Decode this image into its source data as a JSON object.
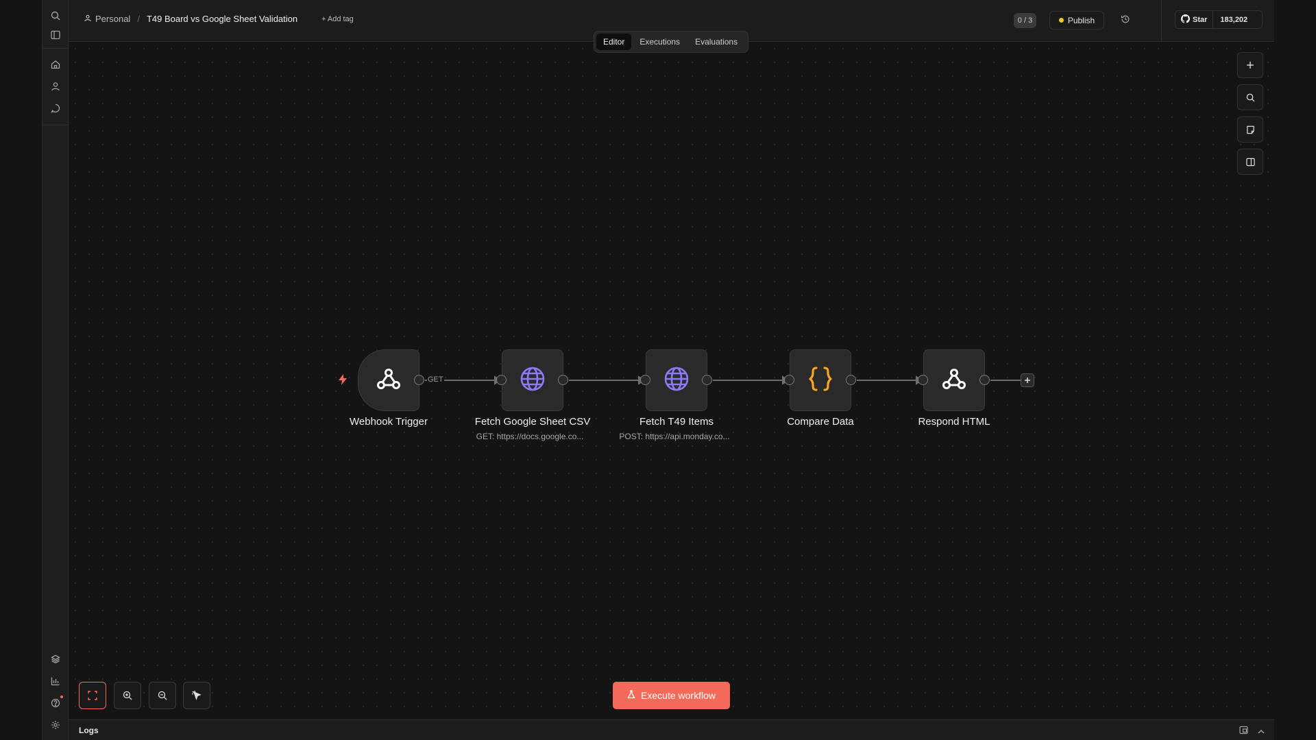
{
  "breadcrumb": {
    "project": "Personal",
    "separator": "/",
    "workflow_name": "T49 Board vs Google Sheet Validation",
    "add_tag": "+ Add tag"
  },
  "header": {
    "counter": "0 / 3",
    "publish_label": "Publish",
    "star_label": "Star",
    "star_count": "183,202"
  },
  "tabs": [
    {
      "label": "Editor",
      "active": true
    },
    {
      "label": "Executions"
    },
    {
      "label": "Evaluations"
    }
  ],
  "nodes": [
    {
      "title": "Webhook Trigger",
      "subtitle": "",
      "icon": "webhook-icon"
    },
    {
      "title": "Fetch Google Sheet CSV",
      "subtitle": "GET: https://docs.google.co...",
      "icon": "globe-icon"
    },
    {
      "title": "Fetch T49 Items",
      "subtitle": "POST: https://api.monday.co...",
      "icon": "globe-icon"
    },
    {
      "title": "Compare Data",
      "subtitle": "",
      "icon": "code-braces-icon"
    },
    {
      "title": "Respond HTML",
      "subtitle": "",
      "icon": "webhook-icon"
    }
  ],
  "edge_labels": {
    "webhook_method": "GET"
  },
  "execute_label": "Execute workflow",
  "logs_label": "Logs",
  "colors": {
    "accent": "#f46a5a",
    "globe": "#8b7cf6",
    "code": "#f5a623",
    "publish_dot": "#f5c518"
  }
}
